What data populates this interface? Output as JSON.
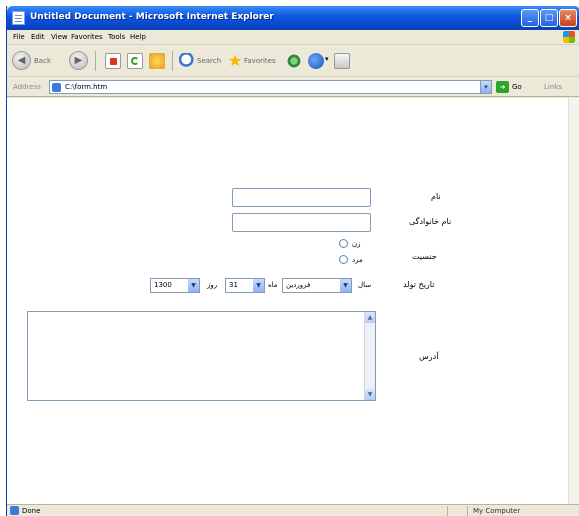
{
  "window": {
    "title": "Untitled Document - Microsoft Internet Explorer",
    "controls": {
      "minimize": "_",
      "maximize": "□",
      "close": "×"
    }
  },
  "menu": {
    "items": [
      "File",
      "Edit",
      "View",
      "Favorites",
      "Tools",
      "Help"
    ]
  },
  "toolbar": {
    "back_label": "Back",
    "search_label": "Search",
    "favorites_label": "Favorites"
  },
  "address_bar": {
    "label": "Address",
    "value": "C:\\form.htm",
    "go_label": "Go",
    "links_label": "Links"
  },
  "form": {
    "first_name_label": "نام",
    "last_name_label": "نام خانوادگی",
    "gender_label": "جنسیت",
    "gender_options": [
      "زن",
      "مرد"
    ],
    "birth_date_label": "تاریخ تولد",
    "year_label": "سال",
    "year_value": "1300",
    "month_label": "ماه",
    "month_value": "فروردین",
    "day_label": "روز",
    "day_value": "31",
    "address_label": "آدرس"
  },
  "status_bar": {
    "status_text": "Done",
    "zone_text": "My Computer"
  }
}
